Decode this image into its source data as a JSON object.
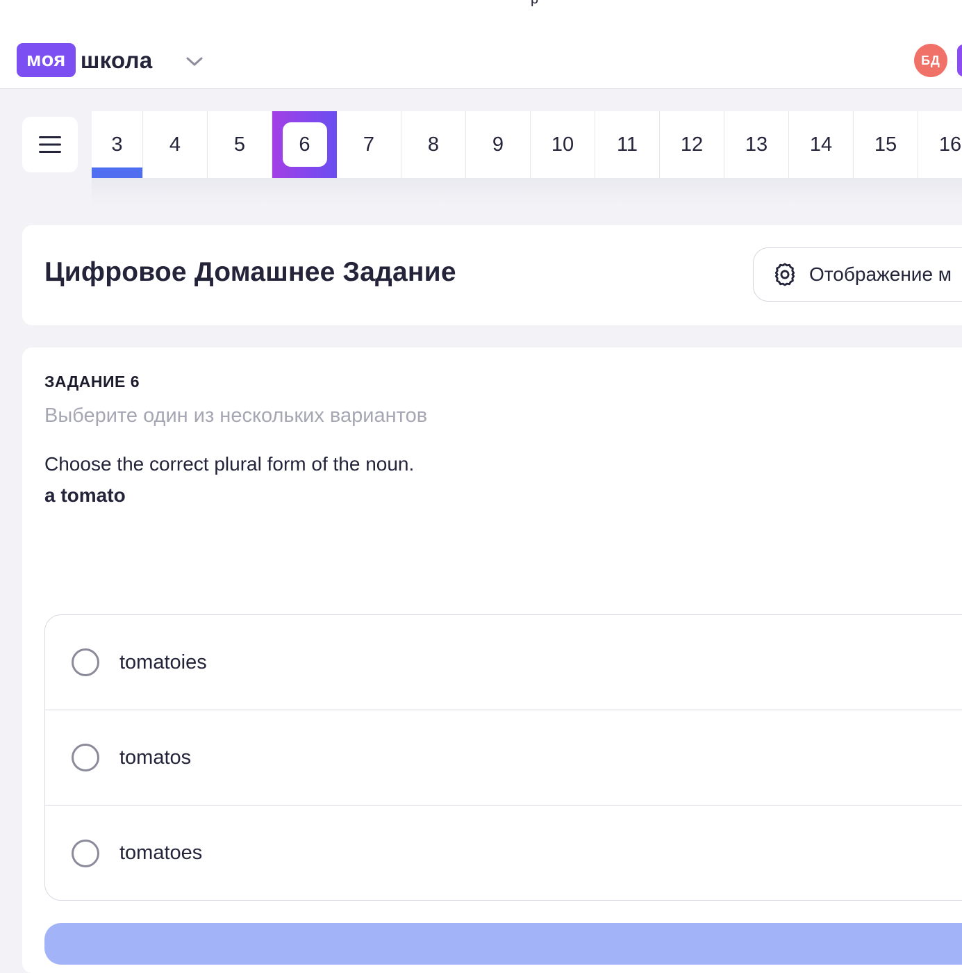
{
  "header": {
    "top_crumb": "р",
    "logo_badge": "моя",
    "logo_text": "школа",
    "avatar_initials": "БД"
  },
  "tabs": [
    "3",
    "4",
    "5",
    "6",
    "7",
    "8",
    "9",
    "10",
    "11",
    "12",
    "13",
    "14",
    "15",
    "16"
  ],
  "active_tab": "6",
  "page": {
    "title": "Цифровое Домашнее Задание",
    "display_button": "Отображение м"
  },
  "task": {
    "label": "ЗАДАНИЕ 6",
    "hint": "Выберите один из нескольких вариантов",
    "question": "Choose the correct plural form of the noun.",
    "noun": "a tomato",
    "options": [
      "tomatoies",
      "tomatos",
      "tomatoes"
    ]
  },
  "colors": {
    "brand": "#7b4ff1",
    "avatar": "#f07168",
    "progress_underline": "#4f6ff0",
    "submit": "#a3b3f7"
  },
  "icons": {
    "menu": "menu-icon",
    "logo_chevron": "chevron-down-icon",
    "display": "gear-icon",
    "radio": "radio-unchecked-icon"
  }
}
